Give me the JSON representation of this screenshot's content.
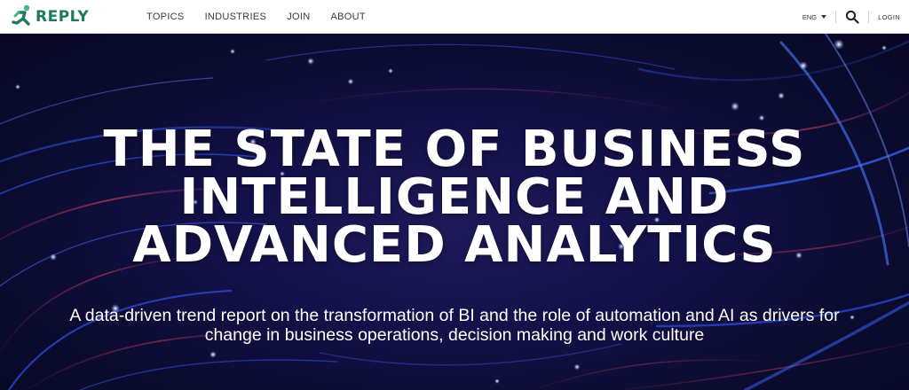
{
  "header": {
    "logo_text": "REPLY",
    "nav": [
      "TOPICS",
      "INDUSTRIES",
      "JOIN",
      "ABOUT"
    ],
    "language": "ENG",
    "login_label": "LOGIN",
    "icons": {
      "logo": "running-figure-logo-icon",
      "language": "caret-down-icon",
      "search": "search-icon"
    }
  },
  "hero": {
    "title_lines": [
      "THE STATE OF BUSINESS",
      "INTELLIGENCE AND",
      "ADVANCED ANALYTICS"
    ],
    "subtitle_lines": [
      "A data-driven trend report on the transformation of BI and the role of automation and AI as drivers for",
      "change in business operations, decision making and work culture"
    ]
  },
  "colors": {
    "brand_green": "#1d7a5f",
    "logo_accent": "#3dbb7a",
    "hero_background": "#14124a",
    "hero_text": "#ffffff"
  }
}
